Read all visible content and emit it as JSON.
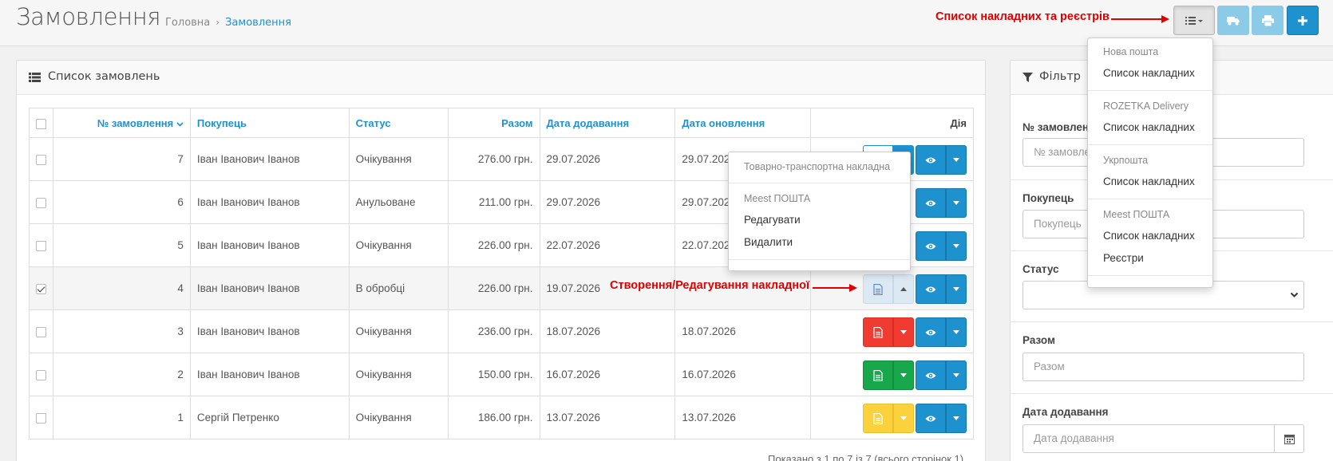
{
  "header": {
    "title": "Замовлення",
    "breadcrumb": [
      "Головна",
      "Замовлення"
    ]
  },
  "annotations": {
    "top": "Список накладних та реєстрів",
    "row": "Створення/Редагування накладної"
  },
  "panel": {
    "title": "Список замовлень"
  },
  "table": {
    "columns": [
      "№ замовлення",
      "Покупець",
      "Статус",
      "Разом",
      "Дата додавання",
      "Дата оновлення",
      "Дія"
    ],
    "rows": [
      {
        "id": "7",
        "customer": "Іван Іванович Іванов",
        "status": "Очікування",
        "total": "276.00 грн.",
        "added": "29.07.2026",
        "updated": "29.07.2026"
      },
      {
        "id": "6",
        "customer": "Іван Іванович Іванов",
        "status": "Анульоване",
        "total": "211.00 грн.",
        "added": "29.07.2026",
        "updated": "29.07.2026"
      },
      {
        "id": "5",
        "customer": "Іван Іванович Іванов",
        "status": "Очікування",
        "total": "226.00 грн.",
        "added": "22.07.2026",
        "updated": "22.07.2026"
      },
      {
        "id": "4",
        "customer": "Іван Іванович Іванов",
        "status": "В обробці",
        "total": "226.00 грн.",
        "added": "19.07.2026",
        "updated": ""
      },
      {
        "id": "3",
        "customer": "Іван Іванович Іванов",
        "status": "Очікування",
        "total": "236.00 грн.",
        "added": "18.07.2026",
        "updated": "18.07.2026"
      },
      {
        "id": "2",
        "customer": "Іван Іванович Іванов",
        "status": "Очікування",
        "total": "150.00 грн.",
        "added": "16.07.2026",
        "updated": "16.07.2026"
      },
      {
        "id": "1",
        "customer": "Сергій Петренко",
        "status": "Очікування",
        "total": "186.00 грн.",
        "added": "13.07.2026",
        "updated": "13.07.2026"
      }
    ],
    "pager": "Показано з 1 по 7 із 7 (всього сторінок 1)"
  },
  "row_dropdown": {
    "header1": "Товарно-транспортна накладна",
    "header2": "Meest ПОШТА",
    "edit": "Редагувати",
    "delete": "Видалити"
  },
  "top_dropdown": {
    "groups": [
      {
        "header": "Нова пошта",
        "items": [
          "Список накладних"
        ]
      },
      {
        "header": "ROZETKA Delivery",
        "items": [
          "Список накладних"
        ]
      },
      {
        "header": "Укрпошта",
        "items": [
          "Список накладних"
        ]
      },
      {
        "header": "Meest ПОШТА",
        "items": [
          "Список накладних",
          "Реєстри"
        ]
      }
    ]
  },
  "filter": {
    "title": "Фільтр",
    "order_label": "№ замовлення",
    "order_placeholder": "№ замовлення",
    "customer_label": "Покупець",
    "customer_placeholder": "Покупець",
    "status_label": "Статус",
    "total_label": "Разом",
    "total_placeholder": "Разом",
    "date_label": "Дата додавання",
    "date_placeholder": "Дата додавання"
  },
  "colors": {
    "primary": "#1e91cf",
    "danger": "#f03b30",
    "success": "#18a74a",
    "warning": "#fbd23b",
    "annotation": "#e00000"
  }
}
